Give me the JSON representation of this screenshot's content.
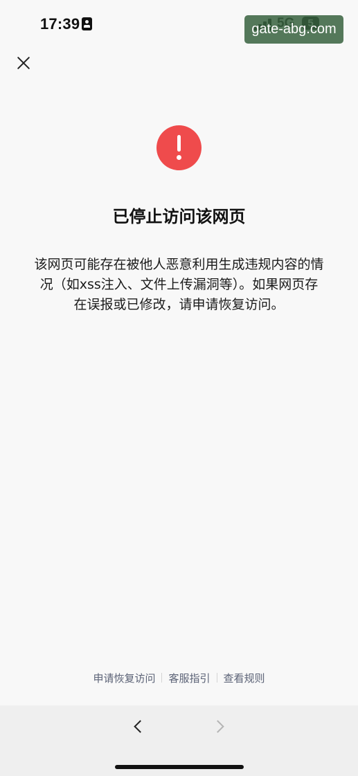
{
  "status_bar": {
    "time": "17:39",
    "network": "5G",
    "battery": "5",
    "icons": [
      "contact-card-icon",
      "signal-icon",
      "battery-icon"
    ]
  },
  "watermark": {
    "text": "gate-abg.com"
  },
  "close_icon": "close-icon",
  "alert": {
    "icon": "exclamation-icon",
    "color": "#ef4b4c"
  },
  "title": "已停止访问该网页",
  "message": {
    "lines": [
      "该网页可能存在被他人恶意利用生成违规内容的情",
      "况（如xss注入、文件上传漏洞等）。如果网页存",
      "在误报或已修改，请申请恢复访问。"
    ]
  },
  "footer": {
    "links": [
      "申请恢复访问",
      "客服指引",
      "查看规则"
    ],
    "color": "#5b6276"
  },
  "bottom_bar": {
    "back_icon": "chevron-left-icon",
    "forward_icon": "chevron-right-icon"
  }
}
